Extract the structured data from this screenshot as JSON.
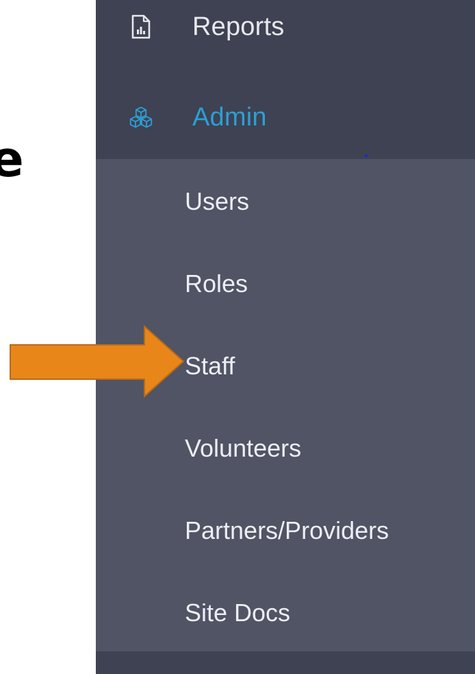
{
  "background": {
    "partial_heading": "e"
  },
  "sidebar": {
    "items": [
      {
        "label": "Reports",
        "icon": "report-file-icon"
      },
      {
        "label": "Admin",
        "icon": "cubes-icon",
        "active": true
      }
    ],
    "submenu": [
      {
        "label": "Users"
      },
      {
        "label": "Roles"
      },
      {
        "label": "Staff",
        "highlighted": true
      },
      {
        "label": "Volunteers"
      },
      {
        "label": "Partners/Providers"
      },
      {
        "label": "Site Docs"
      }
    ]
  },
  "annotation": {
    "icon": "orange-arrow-icon",
    "target": "Staff",
    "color": "#e8861a"
  },
  "colors": {
    "sidebar_bg": "#3e4252",
    "submenu_bg": "#505465",
    "active_accent": "#2c9fd6",
    "text": "#e8e9ee"
  }
}
